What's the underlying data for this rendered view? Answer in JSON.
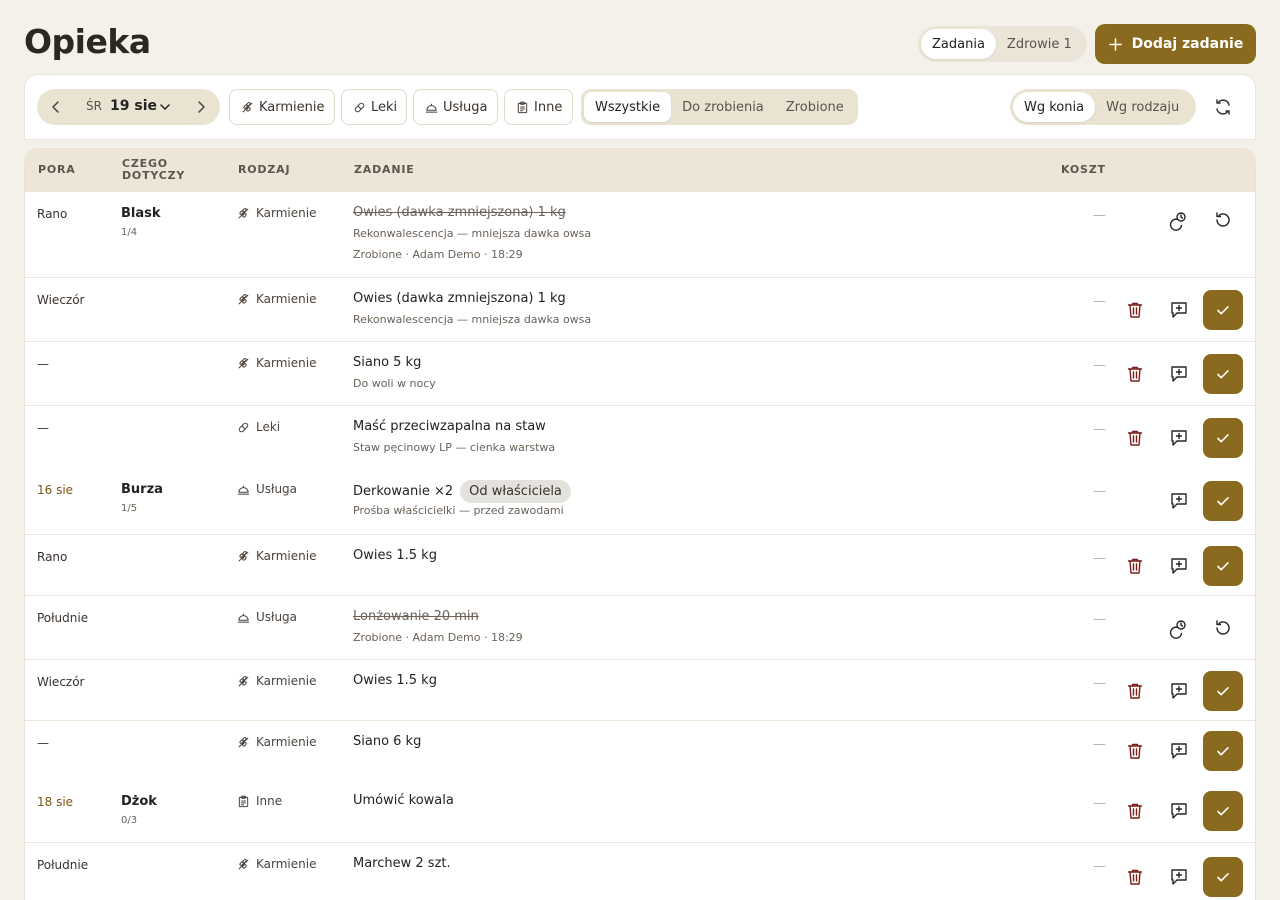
{
  "page": {
    "title": "Opieka"
  },
  "view_toggle": [
    {
      "label": "Zadania",
      "active": true
    },
    {
      "label": "Zdrowie 1",
      "active": false
    }
  ],
  "add_button": {
    "label": "Dodaj zadanie"
  },
  "date_picker": {
    "weekday": "ŚR",
    "date": "19 sie"
  },
  "type_filters": [
    {
      "label": "Karmienie",
      "icon": "feed-icon"
    },
    {
      "label": "Leki",
      "icon": "pill-icon"
    },
    {
      "label": "Usługa",
      "icon": "service-bell-icon"
    },
    {
      "label": "Inne",
      "icon": "clipboard-icon"
    }
  ],
  "status_filters": [
    {
      "label": "Wszystkie",
      "active": true
    },
    {
      "label": "Do zrobienia",
      "active": false
    },
    {
      "label": "Zrobione",
      "active": false
    }
  ],
  "group_by": [
    {
      "label": "Wg konia",
      "active": true
    },
    {
      "label": "Wg rodzaju",
      "active": false
    }
  ],
  "table": {
    "headers": {
      "pora": "PORA",
      "czego1": "CZEGO",
      "czego2": "DOTYCZY",
      "rodzaj": "RODZAJ",
      "zadanie": "ZADANIE",
      "koszt": "KOSZT"
    },
    "rows": [
      {
        "pora": "Rano",
        "horse": "Blask",
        "count": "1/4",
        "kind": "Karmienie",
        "task": "Owies (dawka zmniejszona) 1 kg",
        "sub1": "Rekonwalescencja — mniejsza dawka owsa",
        "sub2": "Zrobione · Adam Demo · 18:29",
        "cost": "—",
        "done": true
      },
      {
        "pora": "Wieczór",
        "kind": "Karmienie",
        "task": "Owies (dawka zmniejszona) 1 kg",
        "sub1": "Rekonwalescencja — mniejsza dawka owsa",
        "cost": "—"
      },
      {
        "pora": "—",
        "kind": "Karmienie",
        "task": "Siano 5 kg",
        "sub1": "Do woli w nocy",
        "cost": "—"
      },
      {
        "pora": "—",
        "kind": "Leki",
        "task": "Maść przeciwzapalna na staw",
        "sub1": "Staw pęcinowy LP — cienka warstwa",
        "cost": "—"
      },
      {
        "pora": "16 sie",
        "horse": "Burza",
        "count": "1/5",
        "kind": "Usługa",
        "task": "Derkowanie ×2",
        "badge": "Od właściciela",
        "sub1": "Prośba właścicielki — przed zawodami",
        "cost": "—"
      },
      {
        "pora": "Rano",
        "kind": "Karmienie",
        "task": "Owies 1.5 kg",
        "cost": "—"
      },
      {
        "pora": "Południe",
        "kind": "Usługa",
        "task": "Lonżowanie 20 min",
        "sub1": "Zrobione · Adam Demo · 18:29",
        "cost": "—",
        "done": true
      },
      {
        "pora": "Wieczór",
        "kind": "Karmienie",
        "task": "Owies 1.5 kg",
        "cost": "—"
      },
      {
        "pora": "—",
        "kind": "Karmienie",
        "task": "Siano 6 kg",
        "cost": "—"
      },
      {
        "pora": "18 sie",
        "horse": "Dżok",
        "count": "0/3",
        "kind": "Inne",
        "task": "Umówić kowala",
        "cost": "—"
      },
      {
        "pora": "Południe",
        "kind": "Karmienie",
        "task": "Marchew 2 szt.",
        "cost": "—"
      }
    ]
  },
  "colors": {
    "accent": "#8a6a1e",
    "background": "#f4f1ea",
    "header_bg": "#ece5d8"
  }
}
